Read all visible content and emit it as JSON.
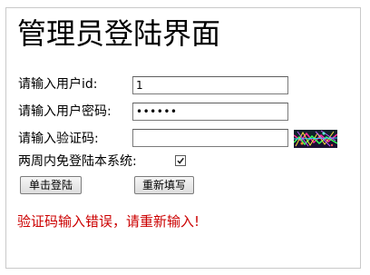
{
  "page": {
    "title": "管理员登陆界面",
    "error_message": "验证码输入错误，请重新输入!"
  },
  "form": {
    "username_label": "请输入用户id:",
    "username_value": "1",
    "password_label": "请输入用户密码:",
    "password_value": "••••••",
    "captcha_label": "请输入验证码:",
    "captcha_value": "",
    "remember_label": "两周内免登陆本系统:",
    "remember_checked": true,
    "login_button": "单击登陆",
    "reset_button": "重新填写"
  },
  "colors": {
    "error": "#cc0000",
    "border": "#7a7a7a"
  }
}
